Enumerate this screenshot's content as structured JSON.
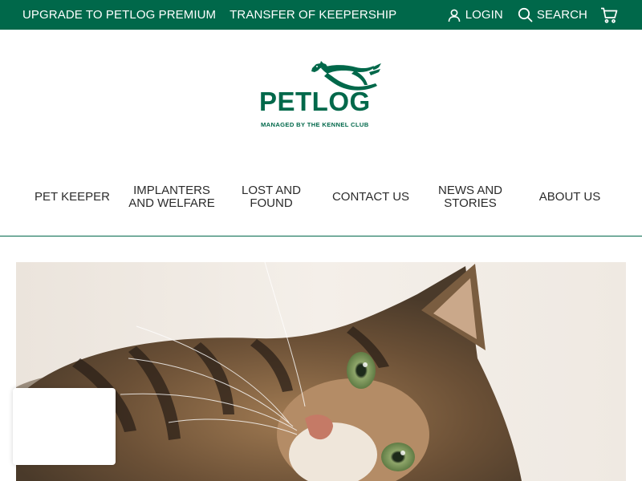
{
  "topbar": {
    "upgrade_label": "UPGRADE TO PETLOG PREMIUM",
    "transfer_label": "TRANSFER OF KEEPERSHIP",
    "login_label": "LOGIN",
    "search_label": "SEARCH",
    "login_icon": "user-icon",
    "search_icon": "search-icon",
    "cart_icon": "cart-icon"
  },
  "logo": {
    "wordmark": "PETLOG",
    "tagline": "MANAGED BY THE KENNEL CLUB"
  },
  "nav": {
    "items": [
      {
        "label": "PET KEEPER"
      },
      {
        "label": "IMPLANTERS AND WELFARE"
      },
      {
        "label": "LOST AND FOUND"
      },
      {
        "label": "CONTACT US"
      },
      {
        "label": "NEWS AND STORIES"
      },
      {
        "label": "ABOUT US"
      }
    ]
  },
  "colors": {
    "brand_green": "#00684a",
    "text": "#2b2b2b"
  }
}
